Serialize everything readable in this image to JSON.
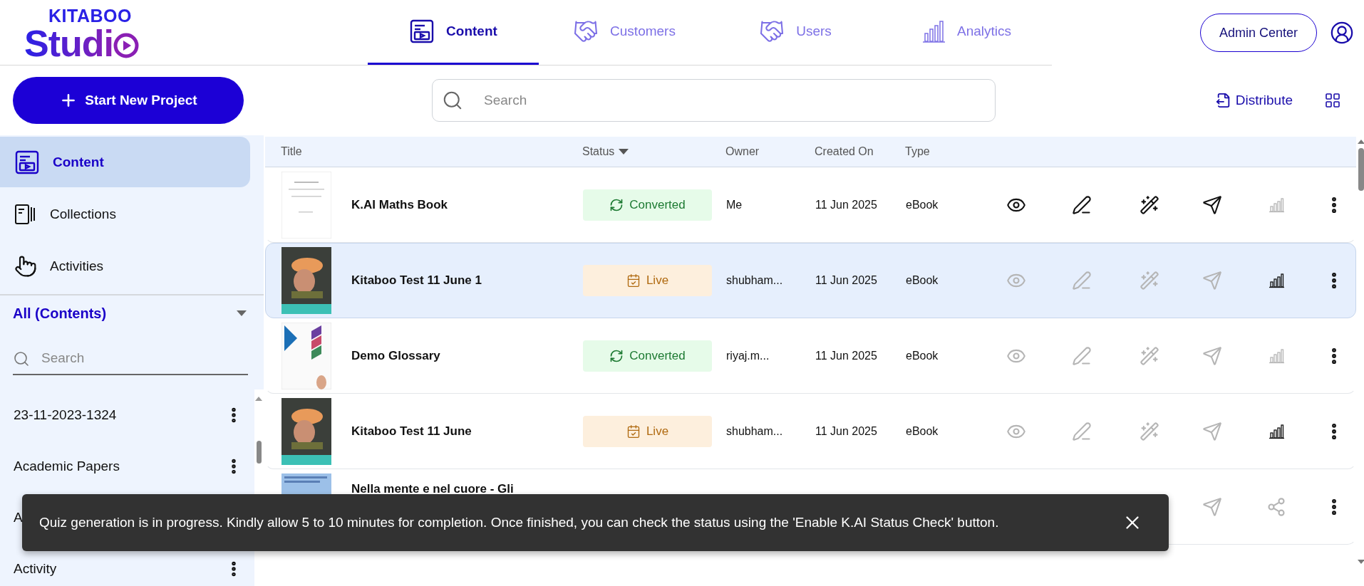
{
  "logo": {
    "top": "KITABOO",
    "bottom": "Studi"
  },
  "tabs": [
    {
      "label": "Content",
      "kind": "content",
      "selected": true
    },
    {
      "label": "Customers",
      "kind": "customers",
      "selected": false
    },
    {
      "label": "Users",
      "kind": "users",
      "selected": false
    },
    {
      "label": "Analytics",
      "kind": "analytics",
      "selected": false
    }
  ],
  "admin_button": "Admin Center",
  "new_project_button": "Start New Project",
  "search": {
    "placeholder": "Search"
  },
  "distribute_button": "Distribute",
  "sidebar": {
    "nav": [
      {
        "label": "Content",
        "kind": "content",
        "selected": true
      },
      {
        "label": "Collections",
        "kind": "collections",
        "selected": false
      },
      {
        "label": "Activities",
        "kind": "activities",
        "selected": false
      }
    ],
    "filter": "All (Contents)",
    "search": {
      "placeholder": "Search"
    },
    "items": [
      {
        "label": "23-11-2023-1324",
        "menu": true
      },
      {
        "label": "Academic Papers",
        "menu": true
      },
      {
        "label": "A"
      },
      {
        "label": "Activity",
        "menu": true
      }
    ]
  },
  "table": {
    "columns": [
      "Title",
      "Status",
      "Owner",
      "Created On",
      "Type"
    ],
    "rows": [
      {
        "title": "K.AI Maths Book",
        "status": {
          "label": "Converted",
          "kind": "converted"
        },
        "owner": "Me",
        "created": "11 Jun 2025",
        "type": "eBook",
        "selected": false,
        "actions": [
          {
            "kind": "view",
            "enabled": true
          },
          {
            "kind": "edit",
            "enabled": true
          },
          {
            "kind": "ai",
            "enabled": true
          },
          {
            "kind": "send",
            "enabled": true
          },
          {
            "kind": "analytics",
            "enabled": false
          }
        ]
      },
      {
        "title": "Kitaboo Test 11 June 1",
        "status": {
          "label": "Live",
          "kind": "live"
        },
        "owner": "shubham...",
        "created": "11 Jun 2025",
        "type": "eBook",
        "selected": true,
        "actions": [
          {
            "kind": "view",
            "enabled": false
          },
          {
            "kind": "edit",
            "enabled": false
          },
          {
            "kind": "ai",
            "enabled": false
          },
          {
            "kind": "send",
            "enabled": false
          },
          {
            "kind": "analytics",
            "enabled": true
          }
        ]
      },
      {
        "title": "Demo Glossary",
        "status": {
          "label": "Converted",
          "kind": "converted"
        },
        "owner": "riyaj.m...",
        "created": "11 Jun 2025",
        "type": "eBook",
        "selected": false,
        "actions": [
          {
            "kind": "view",
            "enabled": false
          },
          {
            "kind": "edit",
            "enabled": false
          },
          {
            "kind": "ai",
            "enabled": false
          },
          {
            "kind": "send",
            "enabled": false
          },
          {
            "kind": "analytics",
            "enabled": false
          }
        ]
      },
      {
        "title": "Kitaboo Test 11 June",
        "status": {
          "label": "Live",
          "kind": "live"
        },
        "owner": "shubham...",
        "created": "11 Jun 2025",
        "type": "eBook",
        "selected": false,
        "actions": [
          {
            "kind": "view",
            "enabled": false
          },
          {
            "kind": "edit",
            "enabled": false
          },
          {
            "kind": "ai",
            "enabled": false
          },
          {
            "kind": "send",
            "enabled": false
          },
          {
            "kind": "analytics",
            "enabled": true
          }
        ]
      },
      {
        "title": "Nella mente e nel cuore - Gli",
        "selected": false,
        "actions": [
          {
            "kind": "send",
            "enabled": false
          },
          {
            "kind": "share",
            "enabled": false
          }
        ]
      }
    ]
  },
  "toast": {
    "message": "Quiz generation is in progress. Kindly allow 5 to 10 minutes for completion. Once finished, you can check the status using the 'Enable K.AI Status Check' button."
  }
}
